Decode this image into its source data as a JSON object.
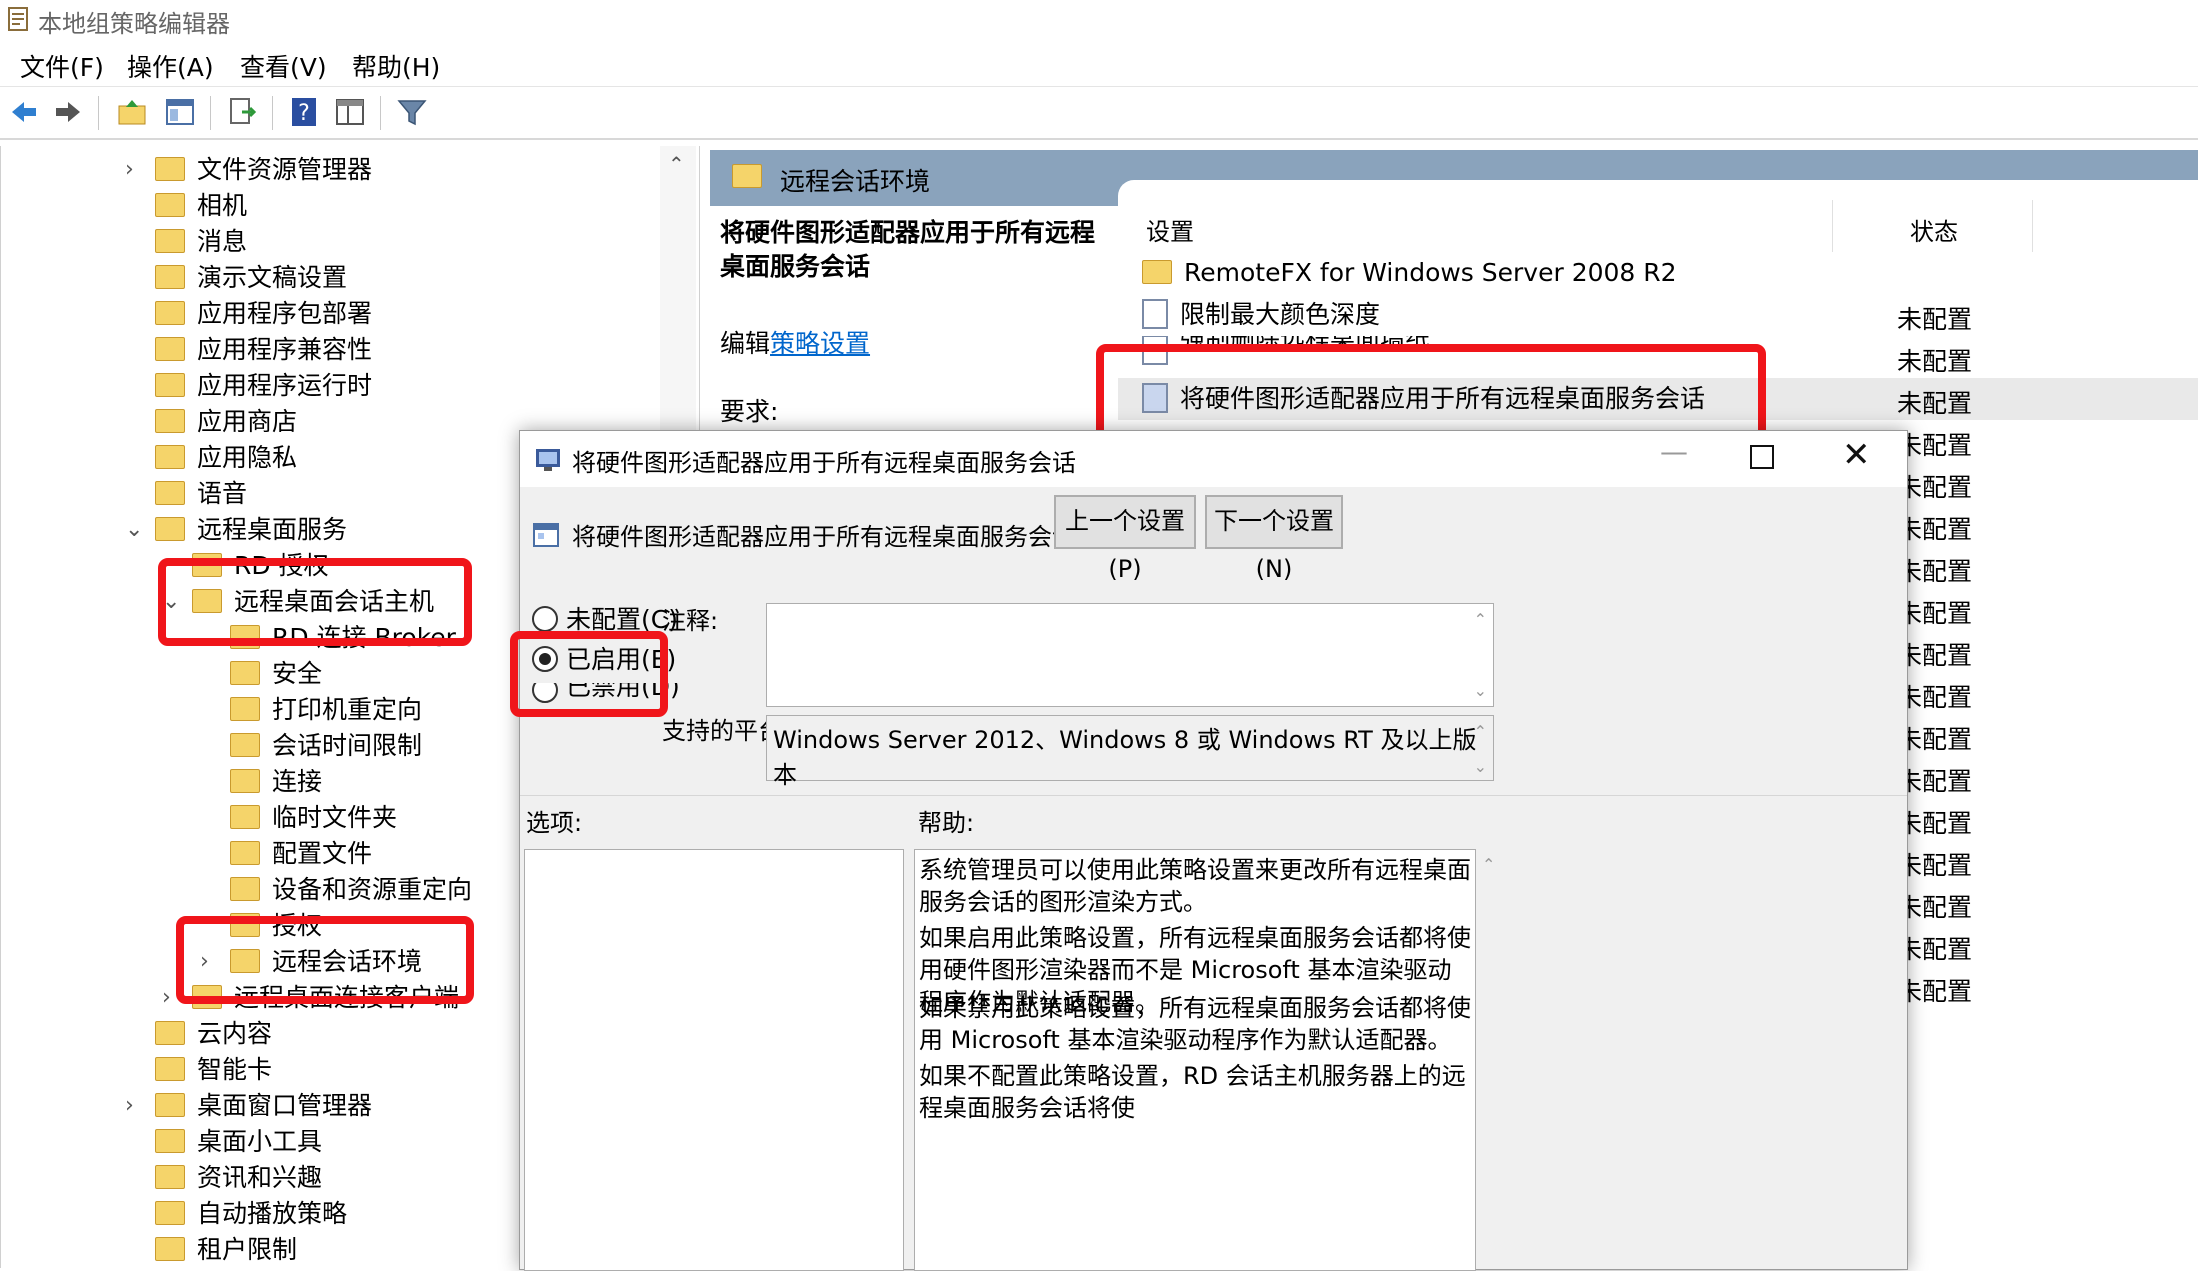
{
  "window": {
    "title": "本地组策略编辑器"
  },
  "menu": [
    "文件(F)",
    "操作(A)",
    "查看(V)",
    "帮助(H)"
  ],
  "toolbar_icons": [
    "back-arrow-icon",
    "forward-arrow-icon",
    "up-folder-icon",
    "show-hide-tree-icon",
    "export-list-icon",
    "help-icon",
    "view-icon",
    "filter-icon"
  ],
  "tree": {
    "items": [
      {
        "label": "文件资源管理器",
        "level": 0,
        "expander": ">"
      },
      {
        "label": "相机",
        "level": 0,
        "expander": ""
      },
      {
        "label": "消息",
        "level": 0,
        "expander": ""
      },
      {
        "label": "演示文稿设置",
        "level": 0,
        "expander": ""
      },
      {
        "label": "应用程序包部署",
        "level": 0,
        "expander": ""
      },
      {
        "label": "应用程序兼容性",
        "level": 0,
        "expander": ""
      },
      {
        "label": "应用程序运行时",
        "level": 0,
        "expander": ""
      },
      {
        "label": "应用商店",
        "level": 0,
        "expander": ""
      },
      {
        "label": "应用隐私",
        "level": 0,
        "expander": ""
      },
      {
        "label": "语音",
        "level": 0,
        "expander": ""
      },
      {
        "label": "远程桌面服务",
        "level": 0,
        "expander": "v"
      },
      {
        "label": "RD 授权",
        "level": 1,
        "expander": ""
      },
      {
        "label": "远程桌面会话主机",
        "level": 1,
        "expander": "v"
      },
      {
        "label": "RD 连接 Broker",
        "level": 2,
        "expander": ""
      },
      {
        "label": "安全",
        "level": 2,
        "expander": ""
      },
      {
        "label": "打印机重定向",
        "level": 2,
        "expander": ""
      },
      {
        "label": "会话时间限制",
        "level": 2,
        "expander": ""
      },
      {
        "label": "连接",
        "level": 2,
        "expander": ""
      },
      {
        "label": "临时文件夹",
        "level": 2,
        "expander": ""
      },
      {
        "label": "配置文件",
        "level": 2,
        "expander": ""
      },
      {
        "label": "设备和资源重定向",
        "level": 2,
        "expander": ""
      },
      {
        "label": "授权",
        "level": 2,
        "expander": ""
      },
      {
        "label": "远程会话环境",
        "level": 2,
        "expander": ">"
      },
      {
        "label": "远程桌面连接客户端",
        "level": 1,
        "expander": ">"
      },
      {
        "label": "云内容",
        "level": 0,
        "expander": ""
      },
      {
        "label": "智能卡",
        "level": 0,
        "expander": ""
      },
      {
        "label": "桌面窗口管理器",
        "level": 0,
        "expander": ">"
      },
      {
        "label": "桌面小工具",
        "level": 0,
        "expander": ""
      },
      {
        "label": "资讯和兴趣",
        "level": 0,
        "expander": ""
      },
      {
        "label": "自动播放策略",
        "level": 0,
        "expander": ""
      },
      {
        "label": "租户限制",
        "level": 0,
        "expander": ""
      }
    ]
  },
  "right": {
    "header": "远程会话环境",
    "policy_title": "将硬件图形适配器应用于所有远程桌面服务会话",
    "edit_prefix": "编辑",
    "edit_link": "策略设置",
    "requirement": "要求:",
    "col_setting": "设置",
    "col_status": "状态",
    "rows": [
      {
        "label": "RemoteFX for Windows Server 2008 R2",
        "status": "",
        "type": "folder"
      },
      {
        "label": "限制最大颜色深度",
        "status": "未配置",
        "type": "policy"
      },
      {
        "label": "强制删除远程桌面墙纸",
        "status": "未配置",
        "type": "policy"
      },
      {
        "label": "将硬件图形适配器应用于所有远程桌面服务会话",
        "status": "未配置",
        "type": "policy"
      }
    ],
    "more_status": [
      "未配置",
      "未配置",
      "未配置",
      "未配置",
      "未配置",
      "未配置",
      "未配置",
      "未配置",
      "未配置",
      "未配置",
      "未配置",
      "未配置",
      "未配置",
      "未配置"
    ]
  },
  "dialog": {
    "title": "将硬件图形适配器应用于所有远程桌面服务会话",
    "subtitle": "将硬件图形适配器应用于所有远程桌面服务会话",
    "prev_button": "上一个设置(P)",
    "next_button": "下一个设置(N)",
    "radio_not_configured": "未配置(C)",
    "radio_enabled": "已启用(E)",
    "radio_disabled": "已禁用(D)",
    "selected": "已启用(E)",
    "comment_label": "注释:",
    "platform_label": "支持的平台:",
    "platform_value": "Windows Server 2012、Windows 8 或 Windows RT 及以上版本",
    "options_label": "选项:",
    "help_label": "帮助:",
    "help_paragraphs": [
      "系统管理员可以使用此策略设置来更改所有远程桌面服务会话的图形渲染方式。",
      "如果启用此策略设置，所有远程桌面服务会话都将使用硬件图形渲染器而不是 Microsoft 基本渲染驱动程序作为默认适配器。",
      "如果禁用此策略设置，所有远程桌面服务会话都将使用 Microsoft 基本渲染驱动程序作为默认适配器。",
      "如果不配置此策略设置，RD 会话主机服务器上的远程桌面服务会话将使"
    ]
  },
  "colors": {
    "highlight_red": "#f0151a",
    "header_blue": "#8aa3bc",
    "link_blue": "#0066cc"
  }
}
